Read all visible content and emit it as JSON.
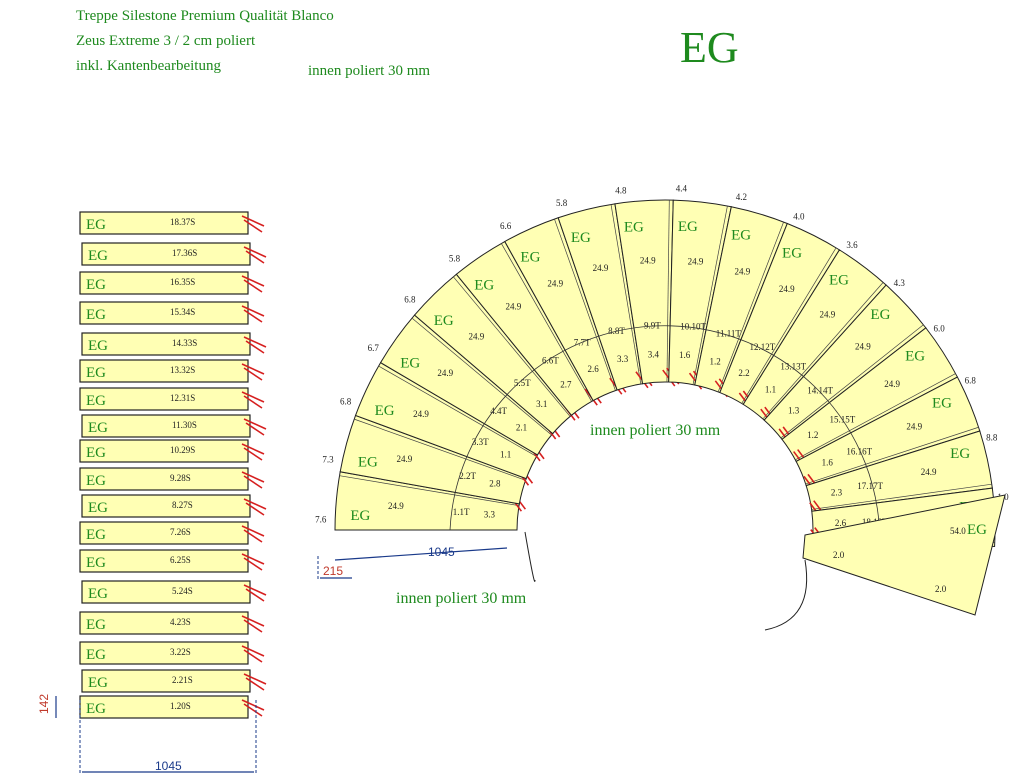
{
  "header": {
    "line1": "Treppe Silestone Premium Qualität Blanco",
    "line2": "Zeus Extreme 3 / 2 cm poliert",
    "line3": "inkl. Kantenbearbeitung",
    "line4": "innen poliert 30 mm",
    "floor": "EG"
  },
  "labels": {
    "inner_center": "innen poliert 30 mm",
    "inner_bottom": "innen poliert 30 mm"
  },
  "stacked_steps": {
    "prefix": "EG",
    "items": [
      "18.37S",
      "17.36S",
      "16.35S",
      "15.34S",
      "14.33S",
      "13.32S",
      "12.31S",
      "11.30S",
      "10.29S",
      "9.28S",
      "8.27S",
      "7.26S",
      "6.25S",
      "5.24S",
      "4.23S",
      "3.22S",
      "2.21S",
      "1.20S"
    ],
    "dim_width": "1045",
    "dim_height": "142"
  },
  "spiral": {
    "prefix": "EG",
    "outer_values": [
      "7.6",
      "7.3",
      "6.8",
      "6.7",
      "6.8",
      "5.8",
      "6.6",
      "5.8",
      "4.8",
      "4.4",
      "4.2",
      "4.0",
      "3.6",
      "4.3",
      "6.0",
      "6.8",
      "8.8",
      "1.0"
    ],
    "depth_label": "24.9",
    "tread_labels": [
      "1.1T",
      "2.2T",
      "3.3T",
      "4.4T",
      "5.5T",
      "6.6T",
      "7.7T",
      "8.8T",
      "9.9T",
      "10.10T",
      "11.11T",
      "12.12T",
      "13.13T",
      "14.14T",
      "15.15T",
      "16.16T",
      "17.17T",
      "18.18T"
    ],
    "inner_values": [
      "3.3",
      "2.8",
      "1.1",
      "2.1",
      "3.1",
      "2.7",
      "2.6",
      "3.3",
      "3.4",
      "1.6",
      "1.2",
      "2.2",
      "1.1",
      "1.3",
      "1.2",
      "1.6",
      "2.3",
      "2.6"
    ],
    "landing_value": "54.0",
    "landing_edges": [
      "2.0",
      "2.0"
    ],
    "dim_length": "1045",
    "dim_offset": "215"
  }
}
